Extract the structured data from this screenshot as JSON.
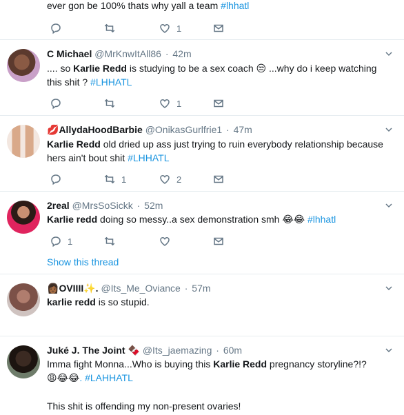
{
  "tweets": [
    {
      "id": "t0",
      "text_parts": [
        "ever gon be 100% thats why yall a team ",
        "#lhhatl"
      ],
      "retweets": "",
      "likes": "1",
      "replies": ""
    },
    {
      "id": "t1",
      "name": "C Michael",
      "handle": "@MrKnwItAll86",
      "time": "42m",
      "text": {
        "pre": ".... so ",
        "bold": "Karlie Redd",
        "mid": " is studying to be a sex coach ",
        "emoji": "😒",
        "post": " ...why do i keep watching this shit ? ",
        "hashtag": "#LHHATL"
      },
      "replies": "",
      "retweets": "",
      "likes": "1"
    },
    {
      "id": "t2",
      "name_emoji": "💋",
      "name": "AllydaHoodBarbie",
      "handle": "@OnikasGurlfrie1",
      "time": "47m",
      "text": {
        "bold": "Karlie Redd",
        "post": " old dried up ass just trying to ruin everybody relationship because hers ain't bout shit ",
        "hashtag": "#LHHATL"
      },
      "replies": "",
      "retweets": "1",
      "likes": "2"
    },
    {
      "id": "t3",
      "name": "2real",
      "handle": "@MrsSoSickk",
      "time": "52m",
      "text": {
        "bold": "Karlie redd",
        "post": "  doing so messy..a sex demonstration smh ",
        "emoji": "😂😂",
        "hashtag": " #lhhatl"
      },
      "replies": "1",
      "retweets": "",
      "likes": "",
      "show_thread": "Show this thread"
    },
    {
      "id": "t4",
      "name_emoji": "👩🏾",
      "name": "OVIIII",
      "name_emoji2": "✨",
      "name_suffix": ".",
      "handle": "@Its_Me_Oviance",
      "time": "57m",
      "text": {
        "bold": "karlie redd",
        "post": " is so stupid."
      }
    },
    {
      "id": "t5",
      "name": "Juké J. The Joint",
      "name_emoji": "🍫",
      "handle": "@Its_jaemazing",
      "time": "60m",
      "text": {
        "pre": "Imma fight Monna...Who is buying this ",
        "bold": "Karlie Redd",
        "post": " pregnancy storyline?!? ",
        "emoji": "😩😂😂",
        "hashtag": ". #LAHHATL",
        "line2": "This shit is offending my non-present ovaries!"
      }
    }
  ],
  "colors": {
    "link": "#1b95e0",
    "muted": "#657786",
    "text": "#14171a",
    "divider": "#e6ecf0"
  },
  "icons": [
    "reply-icon",
    "retweet-icon",
    "like-icon",
    "message-icon",
    "caret-down-icon"
  ]
}
